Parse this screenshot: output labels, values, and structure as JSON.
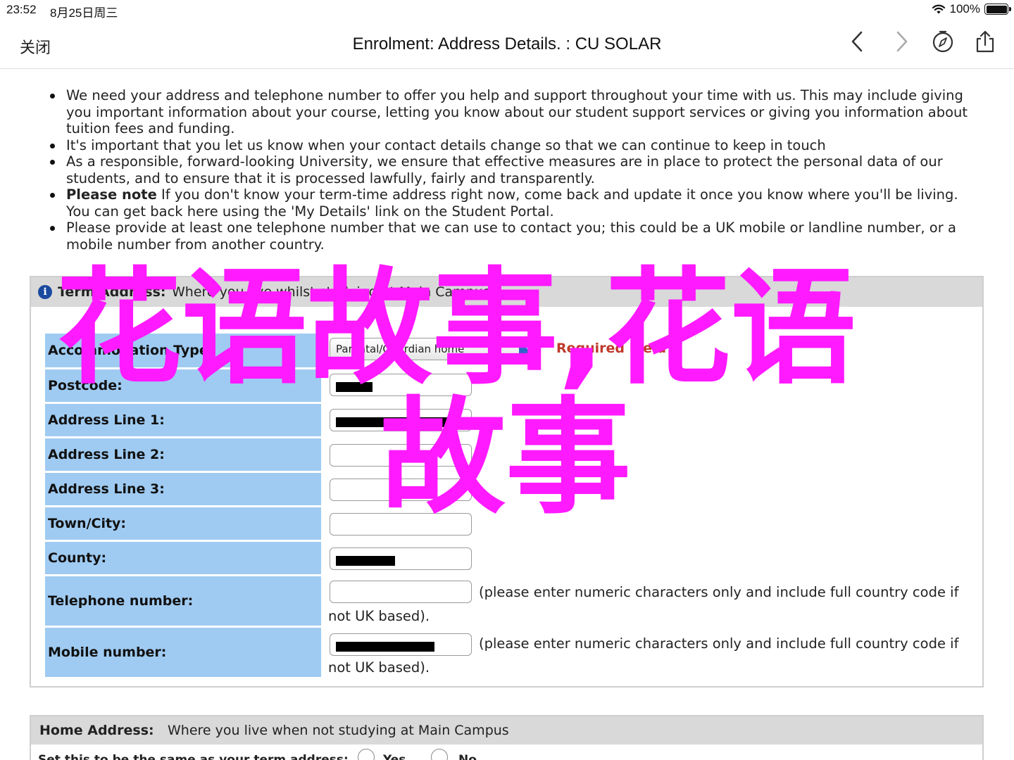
{
  "status_bar": {
    "time": "23:52",
    "date": "8月25日周三",
    "battery_pct": "100%"
  },
  "nav": {
    "close_label": "关闭",
    "title": "Enrolment: Address Details. : CU SOLAR",
    "icons": [
      "chevron-left-icon",
      "chevron-right-icon",
      "compass-icon",
      "share-icon"
    ]
  },
  "intro": {
    "bullets": [
      "We need your address and telephone number to offer you help and support throughout your time with us. This may include giving you important information about your course, letting you know about our student support services or giving you information about tuition fees and funding.",
      "It's important that you let us know when your contact details change so that we can continue to keep in touch",
      "As a responsible, forward-looking University, we ensure that effective measures are in place to protect the personal data of our students, and to ensure that it is processed lawfully, fairly and transparently.",
      "If you don't know your term-time address right now, come back and update it once you know where you'll be living. You can get back here using the 'My Details' link on the Student Portal.",
      "Please provide at least one telephone number that we can use to contact you; this could be a UK mobile or landline number, or a mobile number from another country."
    ],
    "please_note": "Please note"
  },
  "term_panel": {
    "head_label": "Term Address:",
    "head_text": "Where you live whilst studying at Main Campus.",
    "rows": {
      "accommodation_type": {
        "label": "Accommodation Type:",
        "value": "Parental/Guardian home",
        "required": "Required Field"
      },
      "postcode": {
        "label": "Postcode:"
      },
      "address1": {
        "label": "Address Line 1:"
      },
      "address2": {
        "label": "Address Line 2:"
      },
      "address3": {
        "label": "Address Line 3:"
      },
      "town": {
        "label": "Town/City:"
      },
      "county": {
        "label": "County:"
      },
      "telephone": {
        "label": "Telephone number:",
        "hint": "(please enter numeric characters only and include full country code if not UK based)."
      },
      "mobile": {
        "label": "Mobile number:",
        "hint": "(please enter numeric characters only and include full country code if not UK based)."
      }
    }
  },
  "home_panel": {
    "head_label": "Home Address:",
    "head_text": "Where you live when not studying at Main Campus",
    "same_question": "Set this to be the same as your term address:",
    "yes_label": "Yes",
    "no_label": "No"
  },
  "watermark": {
    "line1": "花语故事,花语",
    "line2": "故事",
    "color": "#ff1aff"
  },
  "colors": {
    "label_bg": "#9fcbf2",
    "panel_head_bg": "#d9d9d9",
    "required": "#c0392b",
    "select_arrow": "#2f66c8"
  }
}
